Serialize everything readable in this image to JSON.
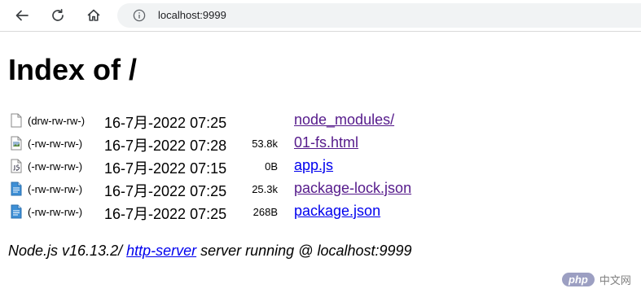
{
  "browser": {
    "url": "localhost:9999",
    "icons": [
      "back-arrow-icon",
      "reload-icon",
      "home-icon",
      "info-icon"
    ]
  },
  "page": {
    "title": "Index of /"
  },
  "entries": [
    {
      "perm": "(drw-rw-rw-)",
      "mtime": "16-7月-2022 07:25",
      "size": "",
      "name": "node_modules/",
      "icon": "blank-file-icon",
      "visited": true
    },
    {
      "perm": "(-rw-rw-rw-)",
      "mtime": "16-7月-2022 07:28",
      "size": "53.8k",
      "name": "01-fs.html",
      "icon": "html-file-icon",
      "visited": true
    },
    {
      "perm": "(-rw-rw-rw-)",
      "mtime": "16-7月-2022 07:15",
      "size": "0B",
      "name": "app.js",
      "icon": "script-file-icon",
      "visited": false
    },
    {
      "perm": "(-rw-rw-rw-)",
      "mtime": "16-7月-2022 07:25",
      "size": "25.3k",
      "name": "package-lock.json",
      "icon": "doc-file-icon",
      "visited": true
    },
    {
      "perm": "(-rw-rw-rw-)",
      "mtime": "16-7月-2022 07:25",
      "size": "268B",
      "name": "package.json",
      "icon": "doc-file-icon",
      "visited": false
    }
  ],
  "footer": {
    "prefix": "Node.js v16.13.2/ ",
    "link": "http-server",
    "suffix": " server running @ localhost:9999"
  },
  "watermark": {
    "badge": "php",
    "text": "中文网"
  },
  "colors": {
    "link": "#0000ee",
    "visited_link": "#551a8b",
    "address_bar": "#f1f3f4"
  }
}
